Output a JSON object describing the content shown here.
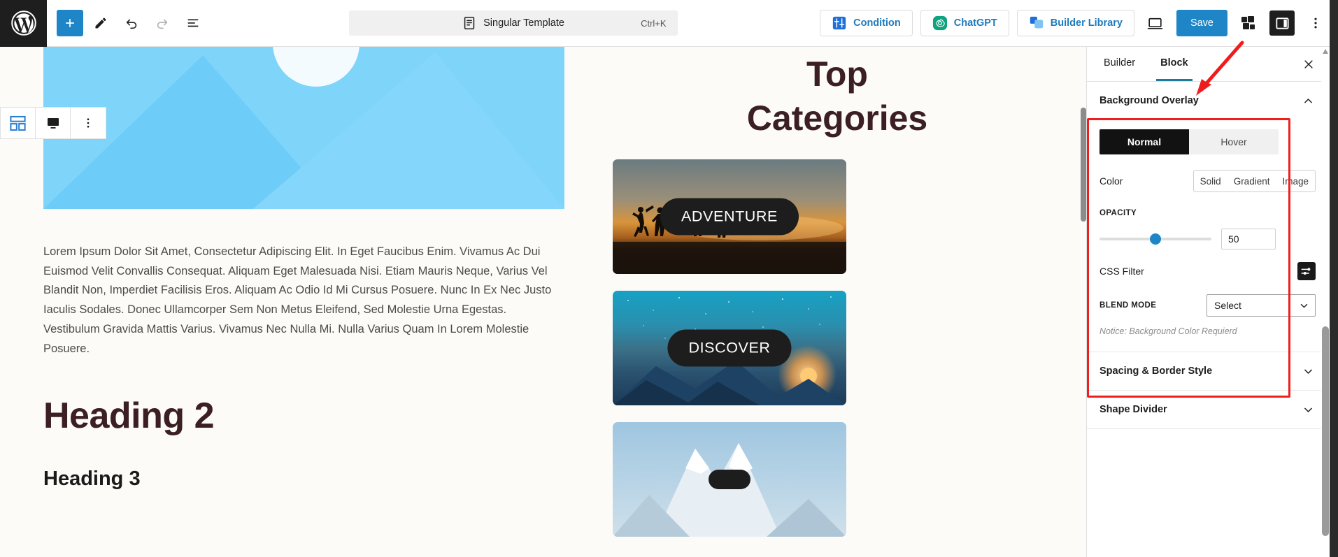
{
  "topbar": {
    "logo_icon": "wordpress-logo-icon",
    "add_block_icon": "plus-icon",
    "edit_icon": "pencil-icon",
    "undo_icon": "undo-arrow-icon",
    "redo_icon": "redo-arrow-icon",
    "list_view_icon": "document-outline-icon",
    "command_title": "Singular Template",
    "command_shortcut": "Ctrl+K",
    "command_icon": "document-icon",
    "condition_label": "Condition",
    "condition_icon": "condition-icon",
    "chatgpt_label": "ChatGPT",
    "chatgpt_icon": "chatgpt-icon",
    "builder_library_label": "Builder Library",
    "builder_library_icon": "builder-library-icon",
    "preview_icon": "laptop-preview-icon",
    "save_label": "Save",
    "patterns_icon": "stacked-squares-icon",
    "settings_panel_icon": "sidebar-toggle-icon",
    "more_icon": "kebab-menu-icon"
  },
  "block_toolbar": {
    "columns_icon": "columns-block-icon",
    "block_type_icon": "block-type-icon",
    "options_icon": "vertical-dots-icon"
  },
  "canvas": {
    "hero_image_alt": "mountain-sunrise-placeholder-illustration",
    "paragraph": "Lorem Ipsum Dolor Sit Amet, Consectetur Adipiscing Elit. In Eget Faucibus Enim. Vivamus Ac Dui Euismod Velit Convallis Consequat. Aliquam Eget Malesuada Nisi. Etiam Mauris Neque, Varius Vel Blandit Non, Imperdiet Facilisis Eros. Aliquam Ac Odio Id Mi Cursus Posuere. Nunc In Ex Nec Justo Iaculis Sodales. Donec Ullamcorper Sem Non Metus Eleifend, Sed Molestie Urna Egestas. Vestibulum Gravida Mattis Varius. Vivamus Nec Nulla Mi. Nulla Varius Quam In Lorem Molestie Posuere.",
    "heading2": "Heading 2",
    "heading3": "Heading 3",
    "categories_title": "Top Categories",
    "cards": [
      {
        "label": "ADVENTURE",
        "image": "people-jumping-sunset-photo"
      },
      {
        "label": "DISCOVER",
        "image": "starry-night-mountains-photo"
      },
      {
        "label": "",
        "image": "snowy-peaks-photo"
      }
    ]
  },
  "sidebar": {
    "tabs": [
      {
        "label": "Builder",
        "active": false
      },
      {
        "label": "Block",
        "active": true
      }
    ],
    "close_icon": "close-x-icon",
    "panels": {
      "background_overlay": {
        "title": "Background Overlay",
        "chevron_icon": "chevron-up-icon",
        "state_tabs": [
          {
            "label": "Normal",
            "active": true
          },
          {
            "label": "Hover",
            "active": false
          }
        ],
        "color_label": "Color",
        "color_types": [
          "Solid",
          "Gradient",
          "Image"
        ],
        "opacity_label": "OPACITY",
        "opacity_value": "50",
        "css_filter_label": "CSS Filter",
        "css_filter_icon": "sliders-filter-icon",
        "blend_mode_label": "BLEND MODE",
        "blend_mode_value": "Select",
        "blend_mode_chevron": "chevron-down-icon",
        "notice": "Notice: Background Color Requierd"
      },
      "spacing_border": {
        "title": "Spacing & Border Style",
        "chevron_icon": "chevron-down-icon"
      },
      "shape_divider": {
        "title": "Shape Divider",
        "chevron_icon": "chevron-down-icon"
      }
    }
  },
  "colors": {
    "accent_blue": "#1e86c7",
    "link_blue": "#1e7bbd",
    "annotation_red": "#f01f1f",
    "tab_underline": "#1c7a9c",
    "heading_maroon": "#3b1f23",
    "canvas_bg": "#fdfbf7"
  }
}
